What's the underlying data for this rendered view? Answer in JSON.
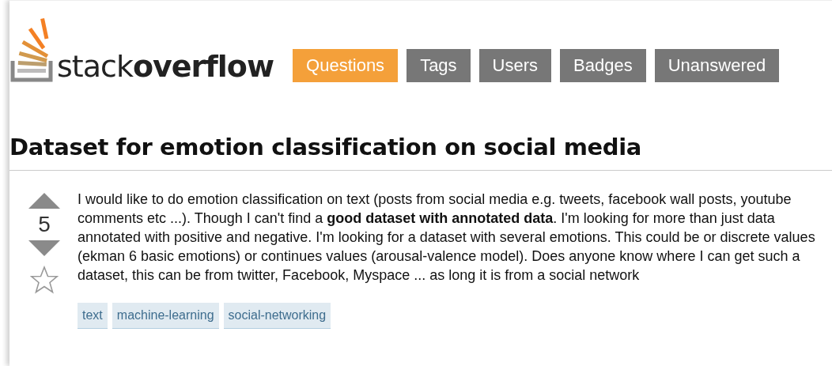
{
  "logo": {
    "text": "stack**overflow**"
  },
  "nav": [
    {
      "label": "Questions",
      "selected": true
    },
    {
      "label": "Tags",
      "selected": false
    },
    {
      "label": "Users",
      "selected": false
    },
    {
      "label": "Badges",
      "selected": false
    },
    {
      "label": "Unanswered",
      "selected": false
    }
  ],
  "question": {
    "title": "Dataset for emotion classification on social media",
    "votes": "5",
    "favorited": false,
    "body": "I would like to do emotion classification on text (posts from social media e.g. tweets, facebook wall posts, youtube comments etc ...). Though I can't find a **good dataset with annotated data**. I'm looking for more than just data annotated with positive and negative. I'm looking for a dataset with several emotions. This could be or discrete values (ekman 6 basic emotions) or continues values (arousal-valence model). Does anyone know where I can get such a dataset, this can be from twitter, Facebook, Myspace ... as long it is from a social network",
    "tags": [
      "text",
      "machine-learning",
      "social-networking"
    ]
  }
}
